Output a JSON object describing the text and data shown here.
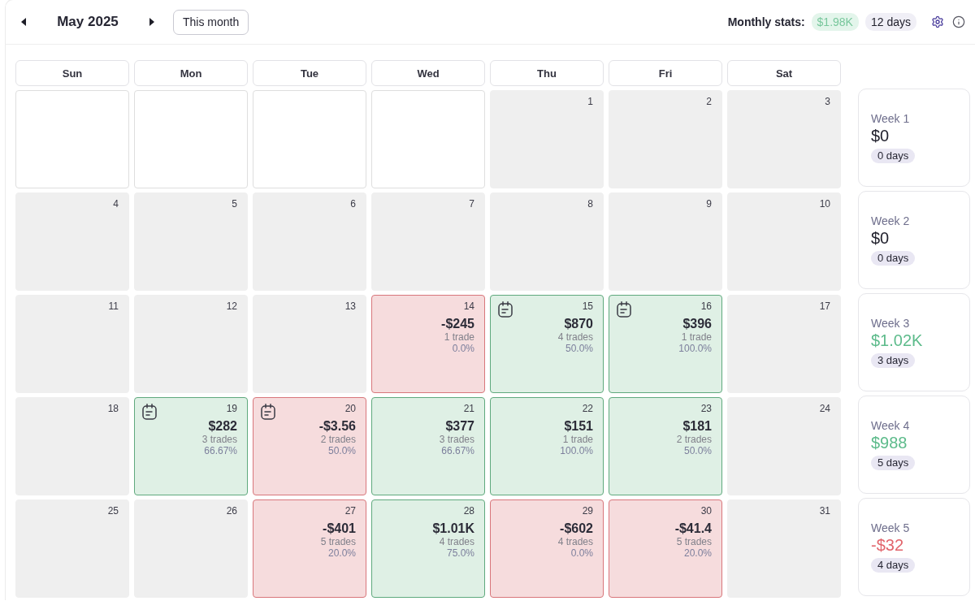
{
  "header": {
    "month": "May 2025",
    "today_button": "This month",
    "stats_label": "Monthly stats:",
    "stats_pnl": "$1.98K",
    "stats_positive": true,
    "stats_days": "12 days"
  },
  "weekdays": [
    "Sun",
    "Mon",
    "Tue",
    "Wed",
    "Thu",
    "Fri",
    "Sat"
  ],
  "weeks": [
    {
      "days": [
        {
          "kind": "blank"
        },
        {
          "kind": "blank"
        },
        {
          "kind": "blank"
        },
        {
          "kind": "blank"
        },
        {
          "kind": "idle",
          "date": "1",
          "note": false
        },
        {
          "kind": "idle",
          "date": "2",
          "note": false
        },
        {
          "kind": "idle",
          "date": "3",
          "note": false
        }
      ],
      "summary": {
        "label": "Week 1",
        "pnl": "$0",
        "color": "#22222e",
        "days": "0 days"
      }
    },
    {
      "days": [
        {
          "kind": "idle",
          "date": "4",
          "note": false
        },
        {
          "kind": "idle",
          "date": "5",
          "note": false
        },
        {
          "kind": "idle",
          "date": "6",
          "note": false
        },
        {
          "kind": "idle",
          "date": "7",
          "note": false
        },
        {
          "kind": "idle",
          "date": "8",
          "note": false
        },
        {
          "kind": "idle",
          "date": "9",
          "note": false
        },
        {
          "kind": "idle",
          "date": "10",
          "note": false
        }
      ],
      "summary": {
        "label": "Week 2",
        "pnl": "$0",
        "color": "#22222e",
        "days": "0 days"
      }
    },
    {
      "days": [
        {
          "kind": "idle",
          "date": "11",
          "note": false
        },
        {
          "kind": "idle",
          "date": "12",
          "note": false
        },
        {
          "kind": "idle",
          "date": "13",
          "note": false
        },
        {
          "kind": "loss",
          "date": "14",
          "note": false,
          "pnl": "-$245",
          "trades": "1 trade",
          "win_rate": "0.0%"
        },
        {
          "kind": "win",
          "date": "15",
          "note": true,
          "pnl": "$870",
          "trades": "4 trades",
          "win_rate": "50.0%"
        },
        {
          "kind": "win",
          "date": "16",
          "note": true,
          "pnl": "$396",
          "trades": "1 trade",
          "win_rate": "100.0%"
        },
        {
          "kind": "idle",
          "date": "17",
          "note": false
        }
      ],
      "summary": {
        "label": "Week 3",
        "pnl": "$1.02K",
        "color": "#5dbb8b",
        "days": "3 days"
      }
    },
    {
      "days": [
        {
          "kind": "idle",
          "date": "18",
          "note": false
        },
        {
          "kind": "win",
          "date": "19",
          "note": true,
          "pnl": "$282",
          "trades": "3 trades",
          "win_rate": "66.67%"
        },
        {
          "kind": "loss",
          "date": "20",
          "note": true,
          "pnl": "-$3.56",
          "trades": "2 trades",
          "win_rate": "50.0%"
        },
        {
          "kind": "win",
          "date": "21",
          "note": false,
          "pnl": "$377",
          "trades": "3 trades",
          "win_rate": "66.67%"
        },
        {
          "kind": "win",
          "date": "22",
          "note": false,
          "pnl": "$151",
          "trades": "1 trade",
          "win_rate": "100.0%"
        },
        {
          "kind": "win",
          "date": "23",
          "note": false,
          "pnl": "$181",
          "trades": "2 trades",
          "win_rate": "50.0%"
        },
        {
          "kind": "idle",
          "date": "24",
          "note": false
        }
      ],
      "summary": {
        "label": "Week 4",
        "pnl": "$988",
        "color": "#5dbb8b",
        "days": "5 days"
      }
    },
    {
      "days": [
        {
          "kind": "idle",
          "date": "25",
          "note": false
        },
        {
          "kind": "idle",
          "date": "26",
          "note": false
        },
        {
          "kind": "loss",
          "date": "27",
          "note": false,
          "pnl": "-$401",
          "trades": "5 trades",
          "win_rate": "20.0%"
        },
        {
          "kind": "win",
          "date": "28",
          "note": false,
          "pnl": "$1.01K",
          "trades": "4 trades",
          "win_rate": "75.0%"
        },
        {
          "kind": "loss",
          "date": "29",
          "note": false,
          "pnl": "-$602",
          "trades": "4 trades",
          "win_rate": "0.0%"
        },
        {
          "kind": "loss",
          "date": "30",
          "note": false,
          "pnl": "-$41.4",
          "trades": "5 trades",
          "win_rate": "20.0%"
        },
        {
          "kind": "idle",
          "date": "31",
          "note": false
        }
      ],
      "summary": {
        "label": "Week 5",
        "pnl": "-$32",
        "color": "#e2656c",
        "days": "4 days"
      }
    }
  ]
}
